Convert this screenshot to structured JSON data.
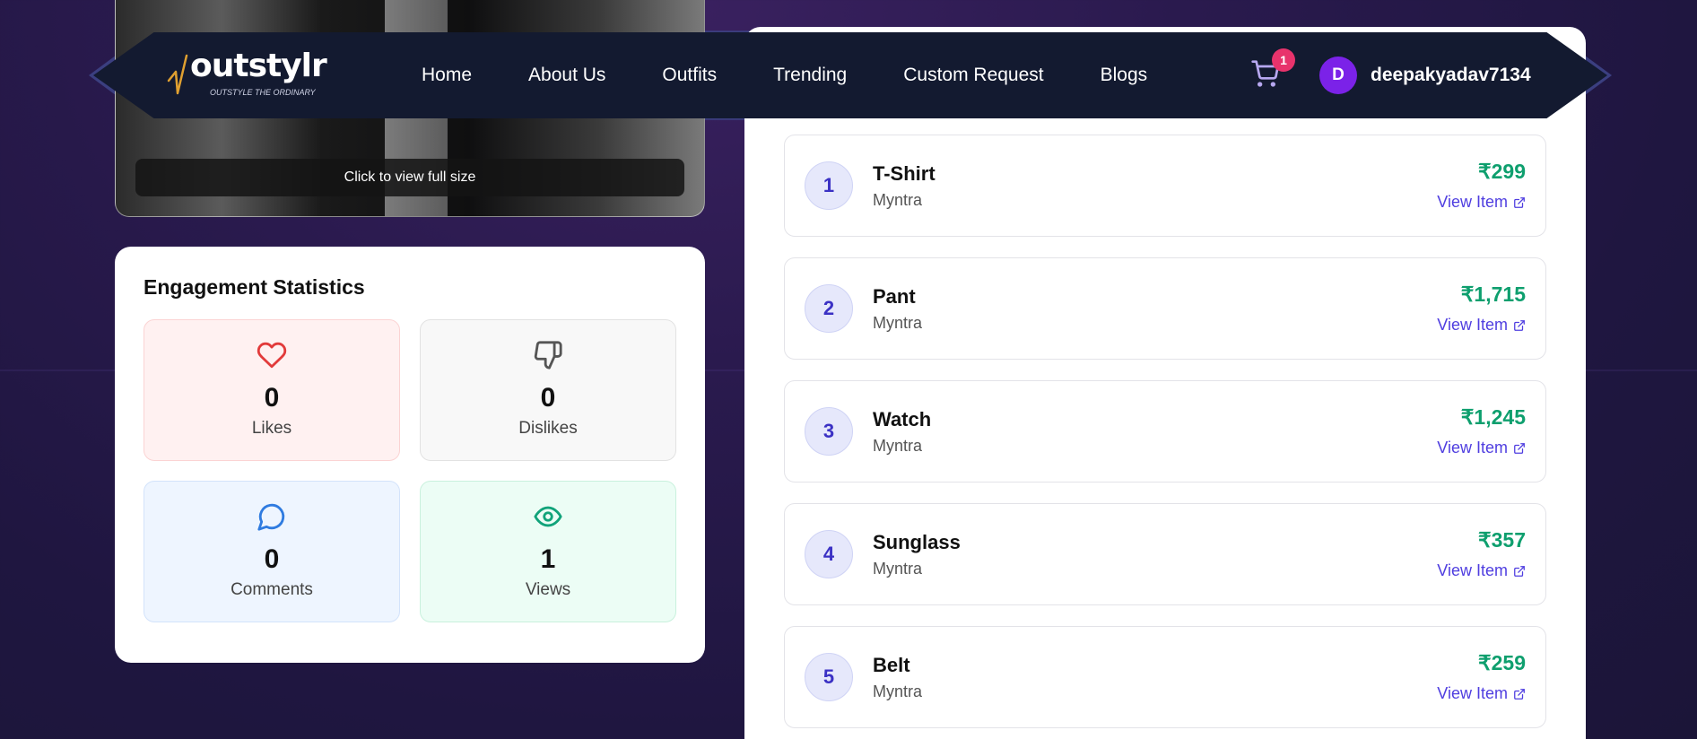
{
  "navbar": {
    "logo_text": "outstylr",
    "logo_tagline": "OUTSTYLE THE ORDINARY",
    "links": [
      "Home",
      "About Us",
      "Outfits",
      "Trending",
      "Custom Request",
      "Blogs"
    ],
    "cart_count": "1",
    "user_initial": "D",
    "username": "deepakyadav7134"
  },
  "image_card": {
    "caption": "Click to view full size"
  },
  "stats": {
    "title": "Engagement Statistics",
    "likes": {
      "value": "0",
      "label": "Likes"
    },
    "dislikes": {
      "value": "0",
      "label": "Dislikes"
    },
    "comments": {
      "value": "0",
      "label": "Comments"
    },
    "views": {
      "value": "1",
      "label": "Views"
    }
  },
  "items": [
    {
      "index": "1",
      "name": "T-Shirt",
      "store": "Myntra",
      "price": "₹299",
      "link_label": "View Item"
    },
    {
      "index": "2",
      "name": "Pant",
      "store": "Myntra",
      "price": "₹1,715",
      "link_label": "View Item"
    },
    {
      "index": "3",
      "name": "Watch",
      "store": "Myntra",
      "price": "₹1,245",
      "link_label": "View Item"
    },
    {
      "index": "4",
      "name": "Sunglass",
      "store": "Myntra",
      "price": "₹357",
      "link_label": "View Item"
    },
    {
      "index": "5",
      "name": "Belt",
      "store": "Myntra",
      "price": "₹259",
      "link_label": "View Item"
    }
  ],
  "colors": {
    "price": "#0e9f6e",
    "link": "#4f3ee0",
    "avatar": "#7b22e8",
    "cart_badge": "#e8336c"
  }
}
